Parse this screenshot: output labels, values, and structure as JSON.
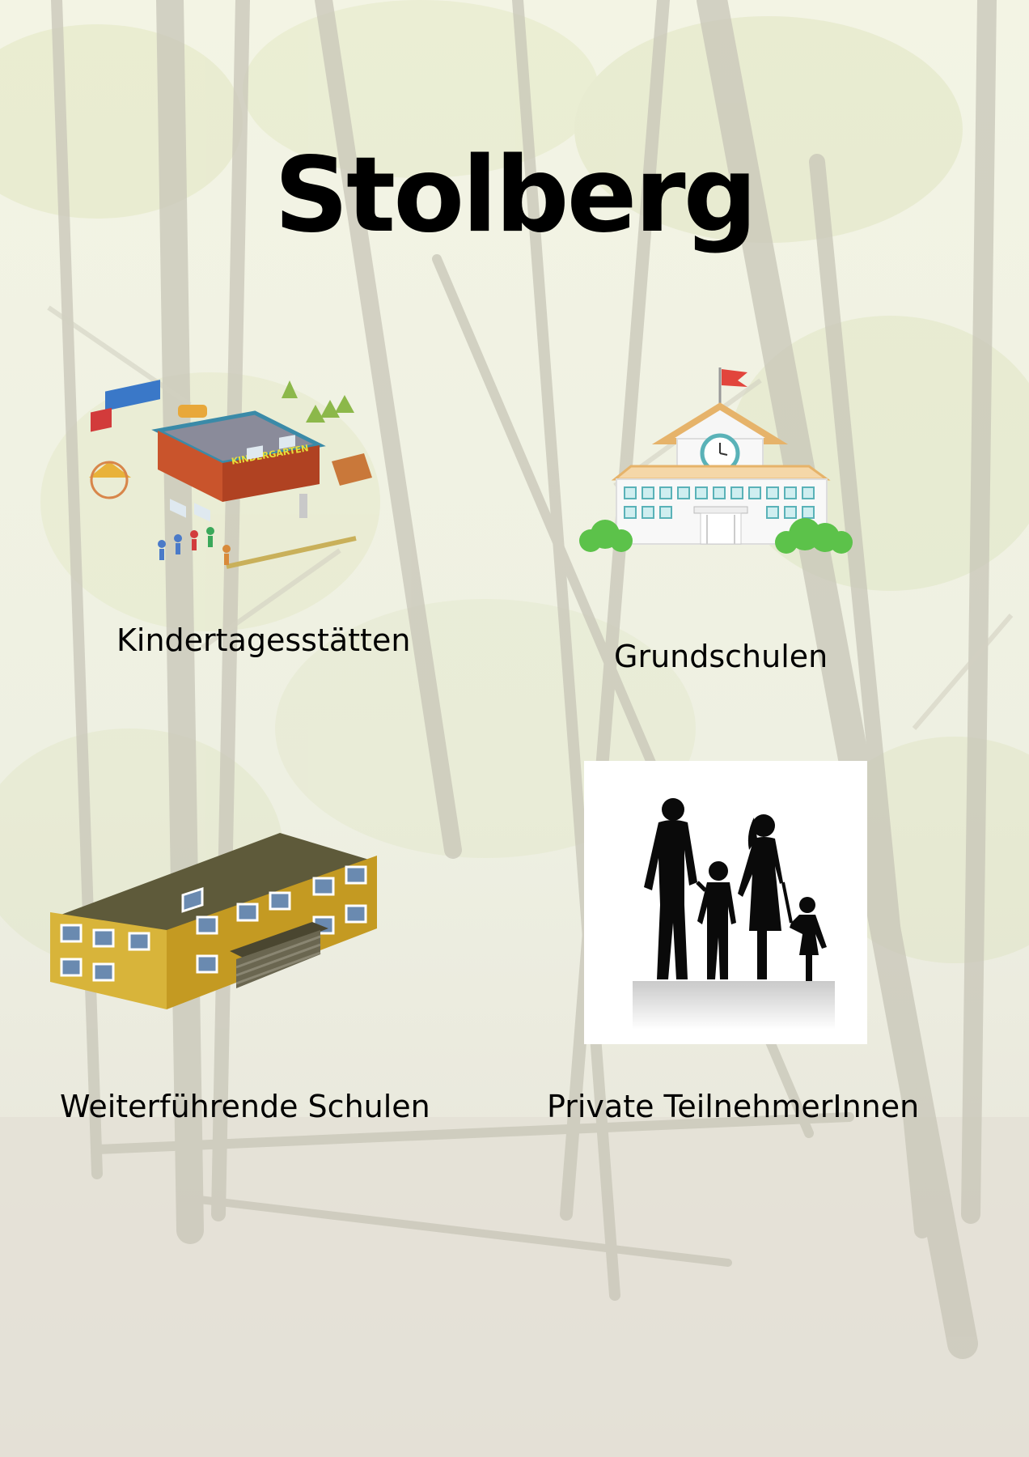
{
  "page": {
    "title": "Stolberg"
  },
  "tiles": [
    {
      "label": "Kindertagesstätten",
      "sign_text": "KINDERGARTEN",
      "icon": "kindergarten-icon"
    },
    {
      "label": "Grundschulen",
      "icon": "primary-school-icon"
    },
    {
      "label": "Weiterführende Schulen",
      "icon": "secondary-school-icon"
    },
    {
      "label": "Private TeilnehmerInnen",
      "icon": "family-silhouette-icon"
    }
  ],
  "colors": {
    "background_tint": "#eef1e4",
    "text": "#000000",
    "school_wall": "#d8b43a",
    "roof": "#5e5a3a",
    "kindergarten_wall": "#c9542c",
    "flag": "#e2453c",
    "bush": "#5cc24a"
  }
}
